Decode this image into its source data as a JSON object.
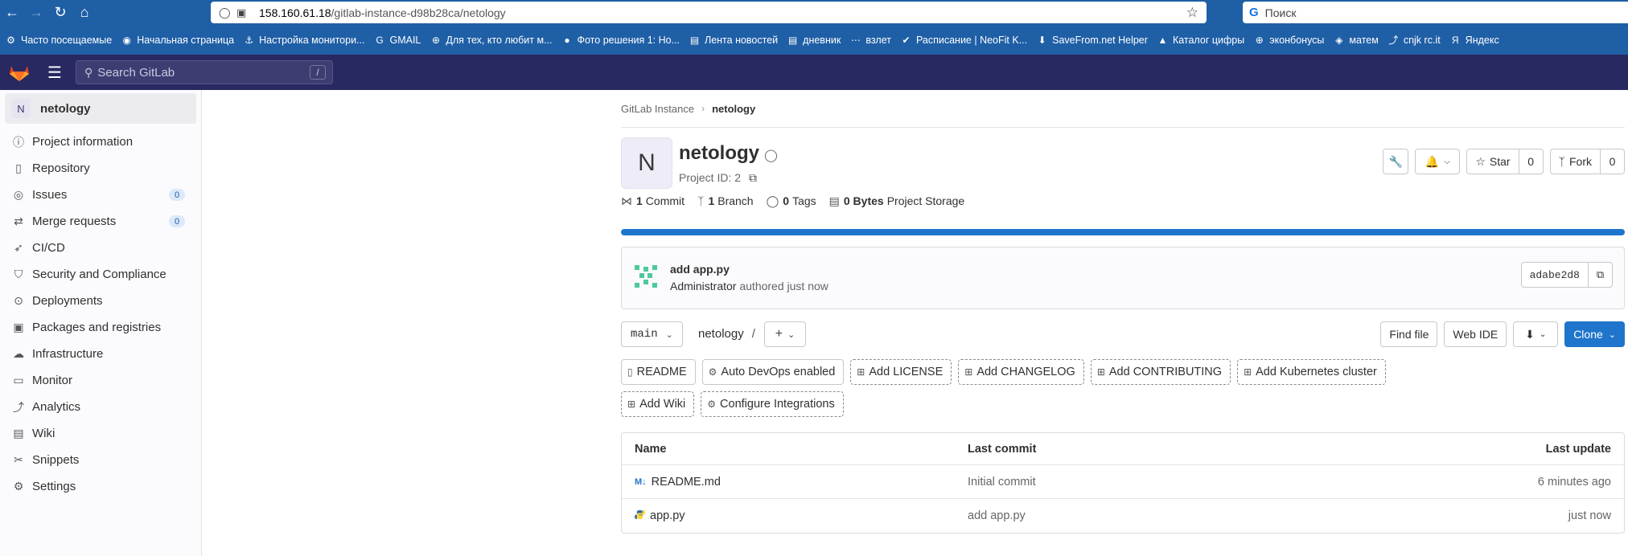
{
  "browser": {
    "url_host": "158.160.61.18",
    "url_path": "/gitlab-instance-d98b28ca/netology",
    "search_placeholder": "Поиск",
    "bookmarks": [
      {
        "label": "Часто посещаемые",
        "icon": "gear-icon"
      },
      {
        "label": "Начальная страница",
        "icon": "firefox-icon"
      },
      {
        "label": "Настройка монитори...",
        "icon": "hook-icon"
      },
      {
        "label": "GMAIL",
        "icon": "google-icon"
      },
      {
        "label": "Для тех, кто любит м...",
        "icon": "globe-icon"
      },
      {
        "label": "Фото решения 1: Но...",
        "icon": "flag-icon"
      },
      {
        "label": "Лента новостей",
        "icon": "book-icon"
      },
      {
        "label": "дневник",
        "icon": "book-icon"
      },
      {
        "label": "взлет",
        "icon": "dots-icon"
      },
      {
        "label": "Расписание | NeoFit K...",
        "icon": "leaf-icon"
      },
      {
        "label": "SaveFrom.net Helper",
        "icon": "download-icon"
      },
      {
        "label": "Каталог цифры",
        "icon": "triangle-icon"
      },
      {
        "label": "эконбонусы",
        "icon": "globe-icon"
      },
      {
        "label": "матем",
        "icon": "puzzle-icon"
      },
      {
        "label": "cnjk rc.it",
        "icon": "chart-icon"
      },
      {
        "label": "Яндекс",
        "icon": "yandex-icon"
      }
    ]
  },
  "gitlab": {
    "search_placeholder": "Search GitLab",
    "search_shortcut": "/"
  },
  "sidebar": {
    "project_initial": "N",
    "project_name": "netology",
    "items": [
      {
        "label": "Project information",
        "icon": "info-icon",
        "badge": ""
      },
      {
        "label": "Repository",
        "icon": "document-icon",
        "badge": ""
      },
      {
        "label": "Issues",
        "icon": "issues-icon",
        "badge": "0"
      },
      {
        "label": "Merge requests",
        "icon": "merge-request-icon",
        "badge": "0"
      },
      {
        "label": "CI/CD",
        "icon": "rocket-icon",
        "badge": ""
      },
      {
        "label": "Security and Compliance",
        "icon": "shield-icon",
        "badge": ""
      },
      {
        "label": "Deployments",
        "icon": "deployments-icon",
        "badge": ""
      },
      {
        "label": "Packages and registries",
        "icon": "package-icon",
        "badge": ""
      },
      {
        "label": "Infrastructure",
        "icon": "cloud-icon",
        "badge": ""
      },
      {
        "label": "Monitor",
        "icon": "monitor-icon",
        "badge": ""
      },
      {
        "label": "Analytics",
        "icon": "chart-icon",
        "badge": ""
      },
      {
        "label": "Wiki",
        "icon": "book-icon",
        "badge": ""
      },
      {
        "label": "Snippets",
        "icon": "scissors-icon",
        "badge": ""
      },
      {
        "label": "Settings",
        "icon": "gear-icon",
        "badge": ""
      }
    ]
  },
  "breadcrumb": {
    "root": "GitLab Instance",
    "current": "netology"
  },
  "project": {
    "initial": "N",
    "name": "netology",
    "id_label": "Project ID: 2",
    "stats": {
      "commits_count": "1",
      "commits_label": "Commit",
      "branches_count": "1",
      "branches_label": "Branch",
      "tags_count": "0",
      "tags_label": "Tags",
      "storage_value": "0 Bytes",
      "storage_label": "Project Storage"
    },
    "star_label": "Star",
    "star_count": "0",
    "fork_label": "Fork",
    "fork_count": "0",
    "progress_percent": 100
  },
  "last_commit": {
    "title": "add app.py",
    "author": "Administrator",
    "when": "authored just now",
    "sha": "adabe2d8"
  },
  "tree": {
    "branch": "main",
    "path": "netology",
    "path_sep": "/",
    "find_file": "Find file",
    "web_ide": "Web IDE",
    "clone": "Clone"
  },
  "quick_actions": [
    {
      "label": "README",
      "icon": "document-icon",
      "style": "solid"
    },
    {
      "label": "Auto DevOps enabled",
      "icon": "gear-icon",
      "style": "solid"
    },
    {
      "label": "Add LICENSE",
      "icon": "plus-square-icon",
      "style": "dashed"
    },
    {
      "label": "Add CHANGELOG",
      "icon": "plus-square-icon",
      "style": "dashed"
    },
    {
      "label": "Add CONTRIBUTING",
      "icon": "plus-square-icon",
      "style": "dashed"
    },
    {
      "label": "Add Kubernetes cluster",
      "icon": "plus-square-icon",
      "style": "dashed"
    },
    {
      "label": "Add Wiki",
      "icon": "plus-square-icon",
      "style": "dashed"
    },
    {
      "label": "Configure Integrations",
      "icon": "gear-icon",
      "style": "dashed"
    }
  ],
  "files": {
    "headers": {
      "name": "Name",
      "last_commit": "Last commit",
      "last_update": "Last update"
    },
    "rows": [
      {
        "name": "README.md",
        "type": "markdown",
        "commit": "Initial commit",
        "updated": "6 minutes ago"
      },
      {
        "name": "app.py",
        "type": "python",
        "commit": "add app.py",
        "updated": "just now"
      }
    ]
  },
  "colors": {
    "browser_chrome": "#1f5fa6",
    "gitlab_header": "#292961",
    "primary": "#1f75cb"
  }
}
